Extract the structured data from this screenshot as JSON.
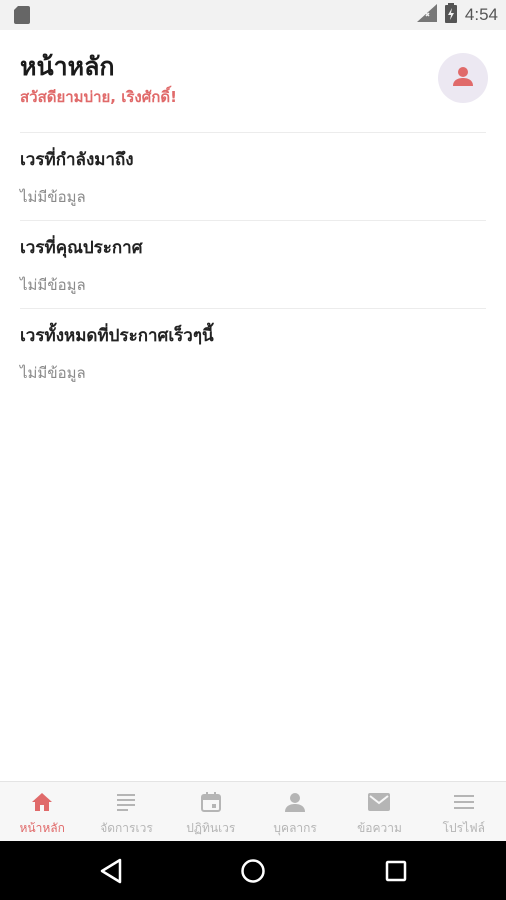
{
  "status_bar": {
    "time": "4:54",
    "icons": [
      "sd-card-icon",
      "signal-icon",
      "battery-icon"
    ]
  },
  "header": {
    "title": "หน้าหลัก",
    "greeting": "สวัสดียามบ่าย, เริงศักดิ์!"
  },
  "sections": [
    {
      "title": "เวรที่กำลังมาถึง",
      "empty_text": "ไม่มีข้อมูล"
    },
    {
      "title": "เวรที่คุณประกาศ",
      "empty_text": "ไม่มีข้อมูล"
    },
    {
      "title": "เวรทั้งหมดที่ประกาศเร็วๆนี้",
      "empty_text": "ไม่มีข้อมูล"
    }
  ],
  "bottom_nav": {
    "items": [
      {
        "label": "หน้าหลัก",
        "icon": "home-icon",
        "active": true
      },
      {
        "label": "จัดการเวร",
        "icon": "list-icon",
        "active": false
      },
      {
        "label": "ปฏิทินเวร",
        "icon": "calendar-icon",
        "active": false
      },
      {
        "label": "บุคลากร",
        "icon": "person-icon",
        "active": false
      },
      {
        "label": "ข้อความ",
        "icon": "mail-icon",
        "active": false
      },
      {
        "label": "โปรไฟล์",
        "icon": "menu-icon",
        "active": false
      }
    ]
  },
  "colors": {
    "accent": "#e06a6a",
    "inactive": "#b5b5b5",
    "avatar_bg": "#ece8f2"
  }
}
